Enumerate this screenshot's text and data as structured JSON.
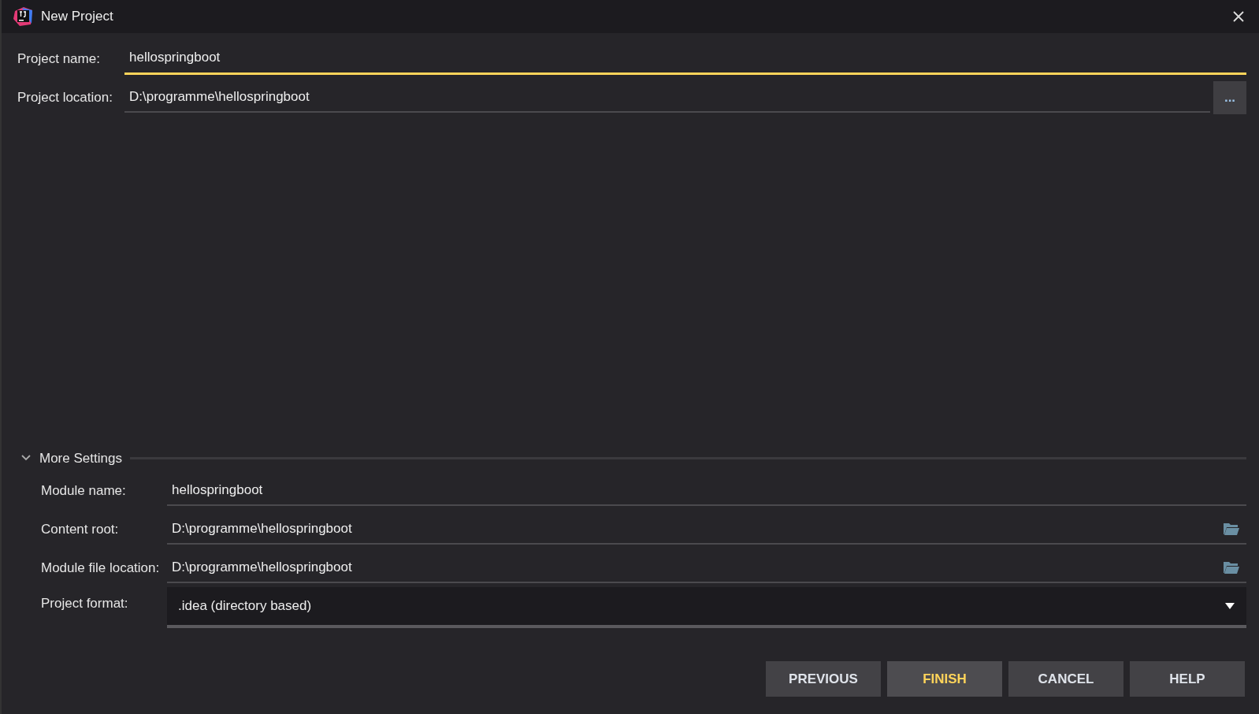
{
  "window": {
    "title": "New Project"
  },
  "top_fields": [
    {
      "label": "Project name:",
      "value": "hellospringboot",
      "focused": true
    },
    {
      "label": "Project location:",
      "value": "D:\\programme\\hellospringboot",
      "focused": false,
      "browse": "..."
    }
  ],
  "more_settings": {
    "label": "More Settings",
    "expanded": true,
    "fields": [
      {
        "kind": "text",
        "label": "Module name:",
        "value": "hellospringboot"
      },
      {
        "kind": "folder",
        "label": "Content root:",
        "value": "D:\\programme\\hellospringboot"
      },
      {
        "kind": "folder",
        "label": "Module file location:",
        "value": "D:\\programme\\hellospringboot"
      },
      {
        "kind": "select",
        "label": "Project format:",
        "value": ".idea (directory based)"
      }
    ]
  },
  "buttons": [
    {
      "label": "PREVIOUS",
      "default": false
    },
    {
      "label": "FINISH",
      "default": true
    },
    {
      "label": "CANCEL",
      "default": false
    },
    {
      "label": "HELP",
      "default": false
    }
  ]
}
